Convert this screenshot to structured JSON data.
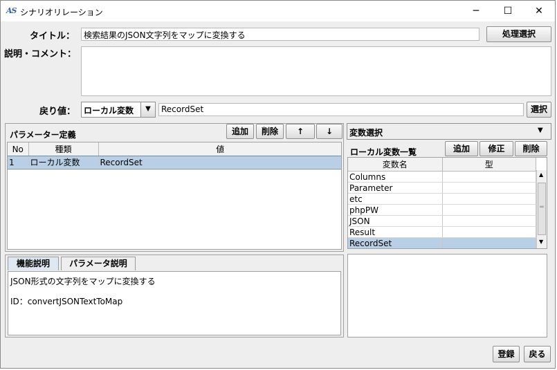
{
  "window": {
    "icon": "AS",
    "title": "シナリオリレーション",
    "minimize": "─",
    "maximize": "☐",
    "close": "✕"
  },
  "form": {
    "title_label": "タイトル：",
    "title_value": "検索結果のJSON文字列をマップに変換する",
    "process_select_button": "処理選択",
    "comment_label": "説明・コメント：",
    "comment_value": "",
    "return_label": "戻り値：",
    "return_type": "ローカル変数",
    "return_value": "RecordSet",
    "select_button": "選択"
  },
  "params": {
    "title": "パラメーター定義",
    "add": "追加",
    "delete": "削除",
    "up": "↑",
    "down": "↓",
    "columns": [
      "No",
      "種類",
      "値"
    ],
    "rows": [
      {
        "no": "1",
        "kind": "ローカル変数",
        "value": "RecordSet"
      }
    ]
  },
  "description": {
    "tabs": [
      "機能説明",
      "パラメータ説明"
    ],
    "line1": "JSON形式の文字列をマップに変換する",
    "line2": "ID：convertJSONTextToMap"
  },
  "variables": {
    "combo": "変数選択",
    "list_title": "ローカル変数一覧",
    "add": "追加",
    "edit": "修正",
    "delete": "削除",
    "columns": [
      "変数名",
      "型"
    ],
    "rows": [
      "Columns",
      "Parameter",
      "etc",
      "phpPW",
      "JSON",
      "Result",
      "RecordSet"
    ],
    "selected": "RecordSet"
  },
  "footer": {
    "register": "登録",
    "back": "戻る"
  }
}
